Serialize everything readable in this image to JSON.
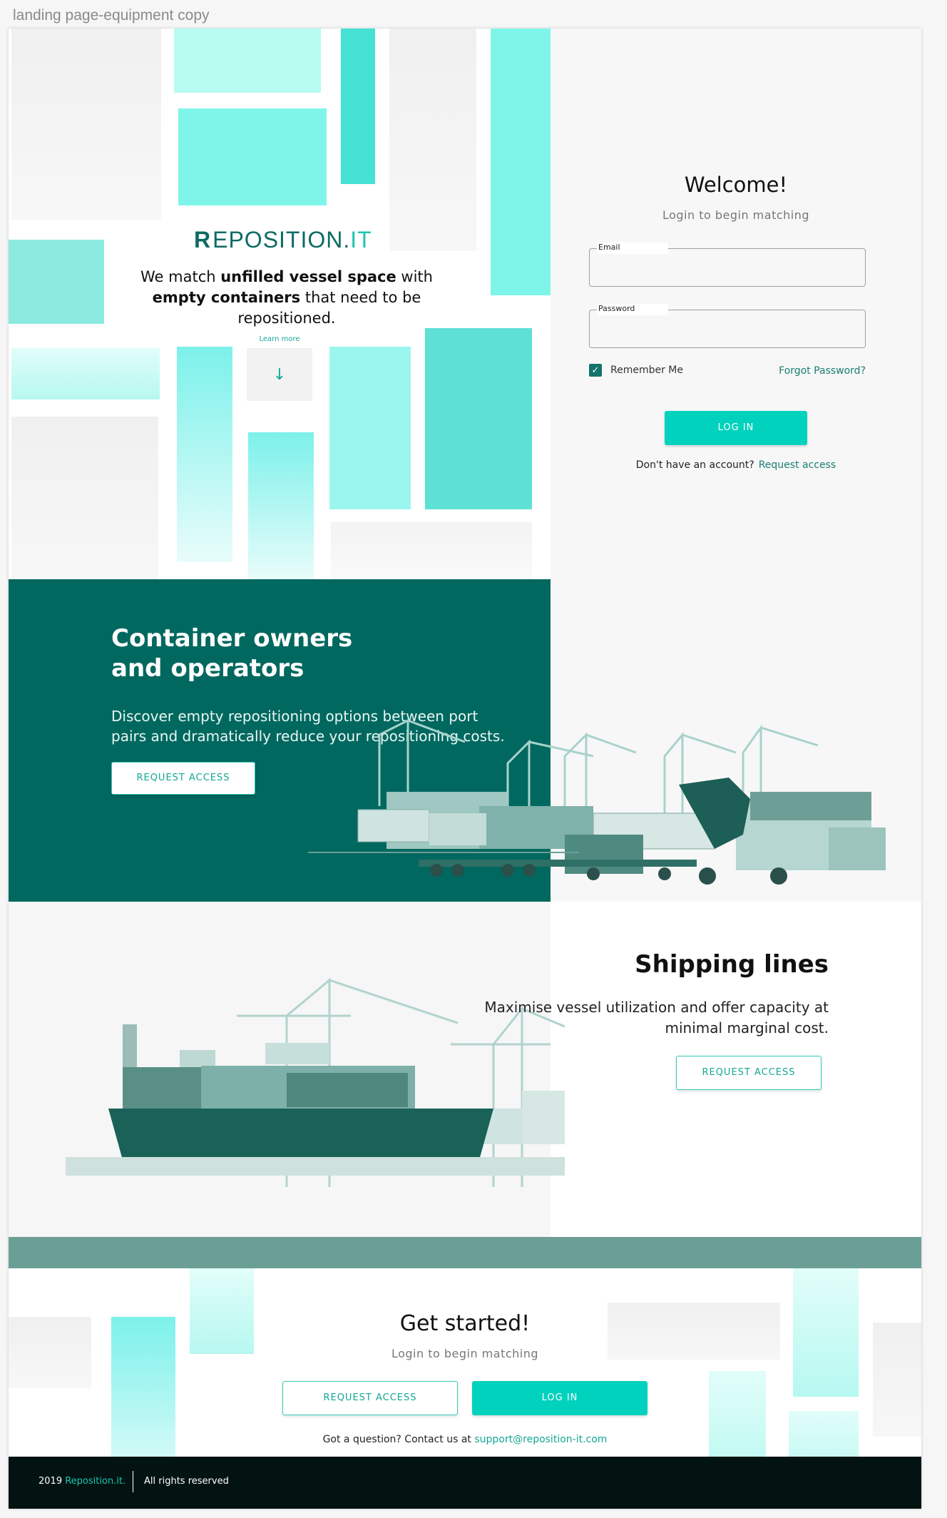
{
  "frame_title": "landing page-equipment copy",
  "hero": {
    "logo_mark": "R",
    "logo_name": "EPOSITION.",
    "logo_suffix": "IT",
    "tagline_1": "We match ",
    "tagline_2": "unfilled vessel space",
    "tagline_3": " with ",
    "tagline_4": "empty containers",
    "tagline_5": " that need to be repositioned.",
    "learn_more": "Learn more",
    "arrow": "↓"
  },
  "login": {
    "title": "Welcome!",
    "subtitle": "Login to begin matching",
    "email_label": "Email",
    "email_value": "",
    "password_label": "Password",
    "password_value": "",
    "remember_label": "Remember Me",
    "remember_checked": true,
    "check_glyph": "✓",
    "forgot_label": "Forgot Password?",
    "login_button": "LOG IN",
    "no_account": "Don't have an account?",
    "request_access": "Request access"
  },
  "owners": {
    "title": "Container owners and operators",
    "text": "Discover empty repositioning options between port pairs and dramatically reduce your repositioning costs.",
    "button": "REQUEST ACCESS"
  },
  "shipping": {
    "title": "Shipping lines",
    "text": "Maximise vessel utilization and offer capacity at minimal marginal cost.",
    "button": "REQUEST ACCESS"
  },
  "started": {
    "title": "Get started!",
    "subtitle": "Login to begin matching",
    "request_button": "REQUEST ACCESS",
    "login_button": "LOG IN",
    "contact_prefix": "Got a question? Contact us at ",
    "contact_email": "support@reposition-it.com"
  },
  "footer": {
    "year": "2019 ",
    "brand": "Reposition.it.",
    "rights": "All rights reserved"
  },
  "colors": {
    "brand_dark": "#00685f",
    "accent": "#00d2bd",
    "footer_bg": "#031312",
    "water": "#6b9f95"
  }
}
